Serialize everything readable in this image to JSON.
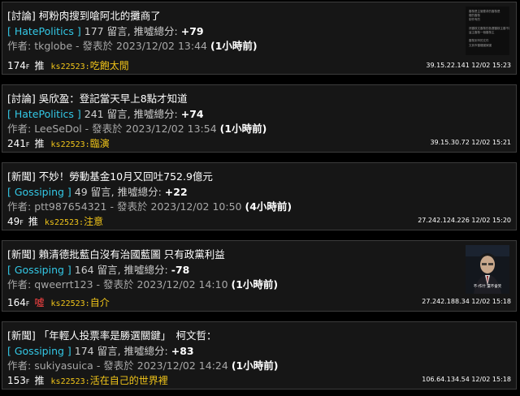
{
  "posts": [
    {
      "title": "[討論] 柯粉肉搜到嗆阿北的攤商了",
      "board": "[ HatePolitics ]",
      "comments": "177",
      "comments_suffix": " 留言, 推噓總分: ",
      "score": "+79",
      "author_prefix": "作者: ",
      "author": "tkglobe",
      "posted_prefix": " - 發表於 ",
      "posted": "2023/12/02 13:44",
      "age": "(1小時前)",
      "floor": "174",
      "floor_suffix": "F",
      "tag": "推",
      "tag_type": "push",
      "pusher": "ks22523:",
      "push_text": "吃飽太閒",
      "ip_date": "39.15.22.141 12/02 15:23",
      "thumb_text": "審核是主管要求的審核是\n權的審核\n制作有的\n\n然審核文審核的各選審核主審不審在一起\n這主審核一個審核主\n\n審核到市的文件\n文到市審權國家國"
    },
    {
      "title": "[討論] 吳欣盈：登記當天早上8點才知道",
      "board": "[ HatePolitics ]",
      "comments": "241",
      "comments_suffix": " 留言, 推噓總分: ",
      "score": "+74",
      "author_prefix": "作者: ",
      "author": "LeeSeDol",
      "posted_prefix": " - 發表於 ",
      "posted": "2023/12/02 13:54",
      "age": "(1小時前)",
      "floor": "241",
      "floor_suffix": "F",
      "tag": "推",
      "tag_type": "push",
      "pusher": "ks22523:",
      "push_text": "臨演",
      "ip_date": "39.15.30.72 12/02 15:21"
    },
    {
      "title": "[新聞] 不妙！勞動基金10月又回吐752.9億元",
      "board": "[ Gossiping ]",
      "comments": "49",
      "comments_suffix": " 留言, 推噓總分: ",
      "score": "+22",
      "author_prefix": "作者: ",
      "author": "ptt987654321",
      "posted_prefix": " - 發表於 ",
      "posted": "2023/12/02 10:50",
      "age": "(4小時前)",
      "floor": "49",
      "floor_suffix": "F",
      "tag": "推",
      "tag_type": "push",
      "pusher": "ks22523:",
      "push_text": "注意",
      "ip_date": "27.242.124.226 12/02 15:20"
    },
    {
      "title": "[新聞] 賴清德批藍白沒有治國藍圖 只有政黨利益",
      "board": "[ Gossiping ]",
      "comments": "164",
      "comments_suffix": " 留言, 推噓總分: ",
      "score": "-78",
      "author_prefix": "作者: ",
      "author": "qweerrt123",
      "posted_prefix": " - 發表於 ",
      "posted": "2023/12/02 14:10",
      "age": "(1小時前)",
      "floor": "164",
      "floor_suffix": "F",
      "tag": "噓",
      "tag_type": "boo",
      "pusher": "ks22523:",
      "push_text": "自介",
      "ip_date": "27.242.188.34 12/02 15:18",
      "thumb_caption": "不-作什 還不會笑"
    },
    {
      "title": "[新聞] 「年輕人投票率是勝選關鍵」　柯文哲：",
      "board": "[ Gossiping ]",
      "comments": "174",
      "comments_suffix": " 留言, 推噓總分: ",
      "score": "+83",
      "author_prefix": "作者: ",
      "author": "sukiyasuica",
      "posted_prefix": " - 發表於 ",
      "posted": "2023/12/02 14:24",
      "age": "(1小時前)",
      "floor": "153",
      "floor_suffix": "F",
      "tag": "推",
      "tag_type": "push",
      "pusher": "ks22523:",
      "push_text": "活在自己的世界裡",
      "ip_date": "106.64.134.54 12/02 15:18"
    }
  ]
}
